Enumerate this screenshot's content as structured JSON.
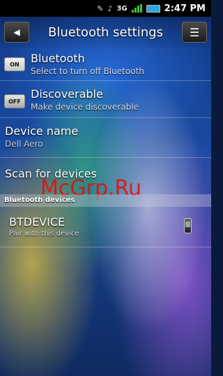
{
  "status_bar": {
    "network": "3G",
    "time": "2:47 PM"
  },
  "header": {
    "title": "Bluetooth settings"
  },
  "settings": [
    {
      "title": "Bluetooth",
      "subtitle": "Select to turn off Bluetooth",
      "toggle": "ON"
    },
    {
      "title": "Discoverable",
      "subtitle": "Make device discoverable",
      "toggle": "OFF"
    },
    {
      "title": "Device name",
      "subtitle": "Dell Aero"
    },
    {
      "title": "Scan for devices"
    }
  ],
  "section": {
    "label": "Bluetooth devices"
  },
  "devices": [
    {
      "name": "BTDEVICE",
      "subtitle": "Pair with this device"
    }
  ],
  "watermark": "McGrp.Ru"
}
